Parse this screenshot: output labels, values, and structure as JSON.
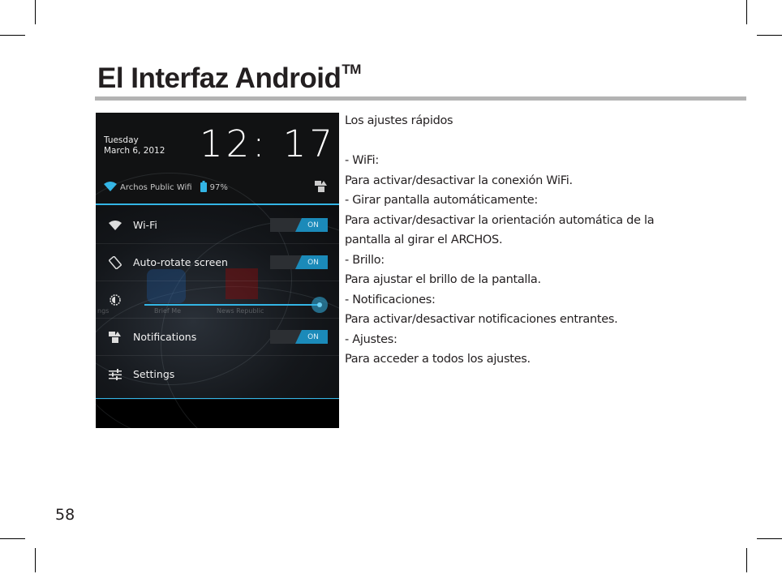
{
  "page": {
    "title": "El Interfaz Android",
    "title_trademark": "TM",
    "page_number": "58"
  },
  "screenshot": {
    "date_day": "Tuesday",
    "date_full": "March 6, 2012",
    "clock": "12: 17",
    "wifi_network": "Archos Public Wifi",
    "battery": "97%",
    "quick_settings": [
      {
        "label": "Wi-Fi",
        "icon": "wifi-icon",
        "toggle": "ON"
      },
      {
        "label": "Auto-rotate screen",
        "icon": "rotate-icon",
        "toggle": "ON"
      },
      {
        "label": "Brightness",
        "icon": "brightness-icon",
        "slider_level_percent": 100
      },
      {
        "label": "Notifications",
        "icon": "notifications-icon",
        "toggle": "ON"
      },
      {
        "label": "Settings",
        "icon": "settings-sliders-icon"
      }
    ],
    "background_apps": [
      "ngs",
      "Brief Me",
      "News Republic"
    ],
    "colors": {
      "accent": "#33b5e5",
      "toggle_on": "#1b8ab9"
    }
  },
  "description": {
    "heading": "Los ajustes rápidos",
    "lines": [
      "- WiFi:",
      "Para activar/desactivar la conexión WiFi.",
      "- Girar pantalla automáticamente:",
      "Para activar/desactivar la orientación automática de la",
      "pantalla al girar el ARCHOS.",
      "- Brillo:",
      "Para ajustar el brillo de la pantalla.",
      "- Notificaciones:",
      "Para activar/desactivar notificaciones entrantes.",
      "- Ajustes:",
      "Para acceder a todos los ajustes."
    ]
  }
}
